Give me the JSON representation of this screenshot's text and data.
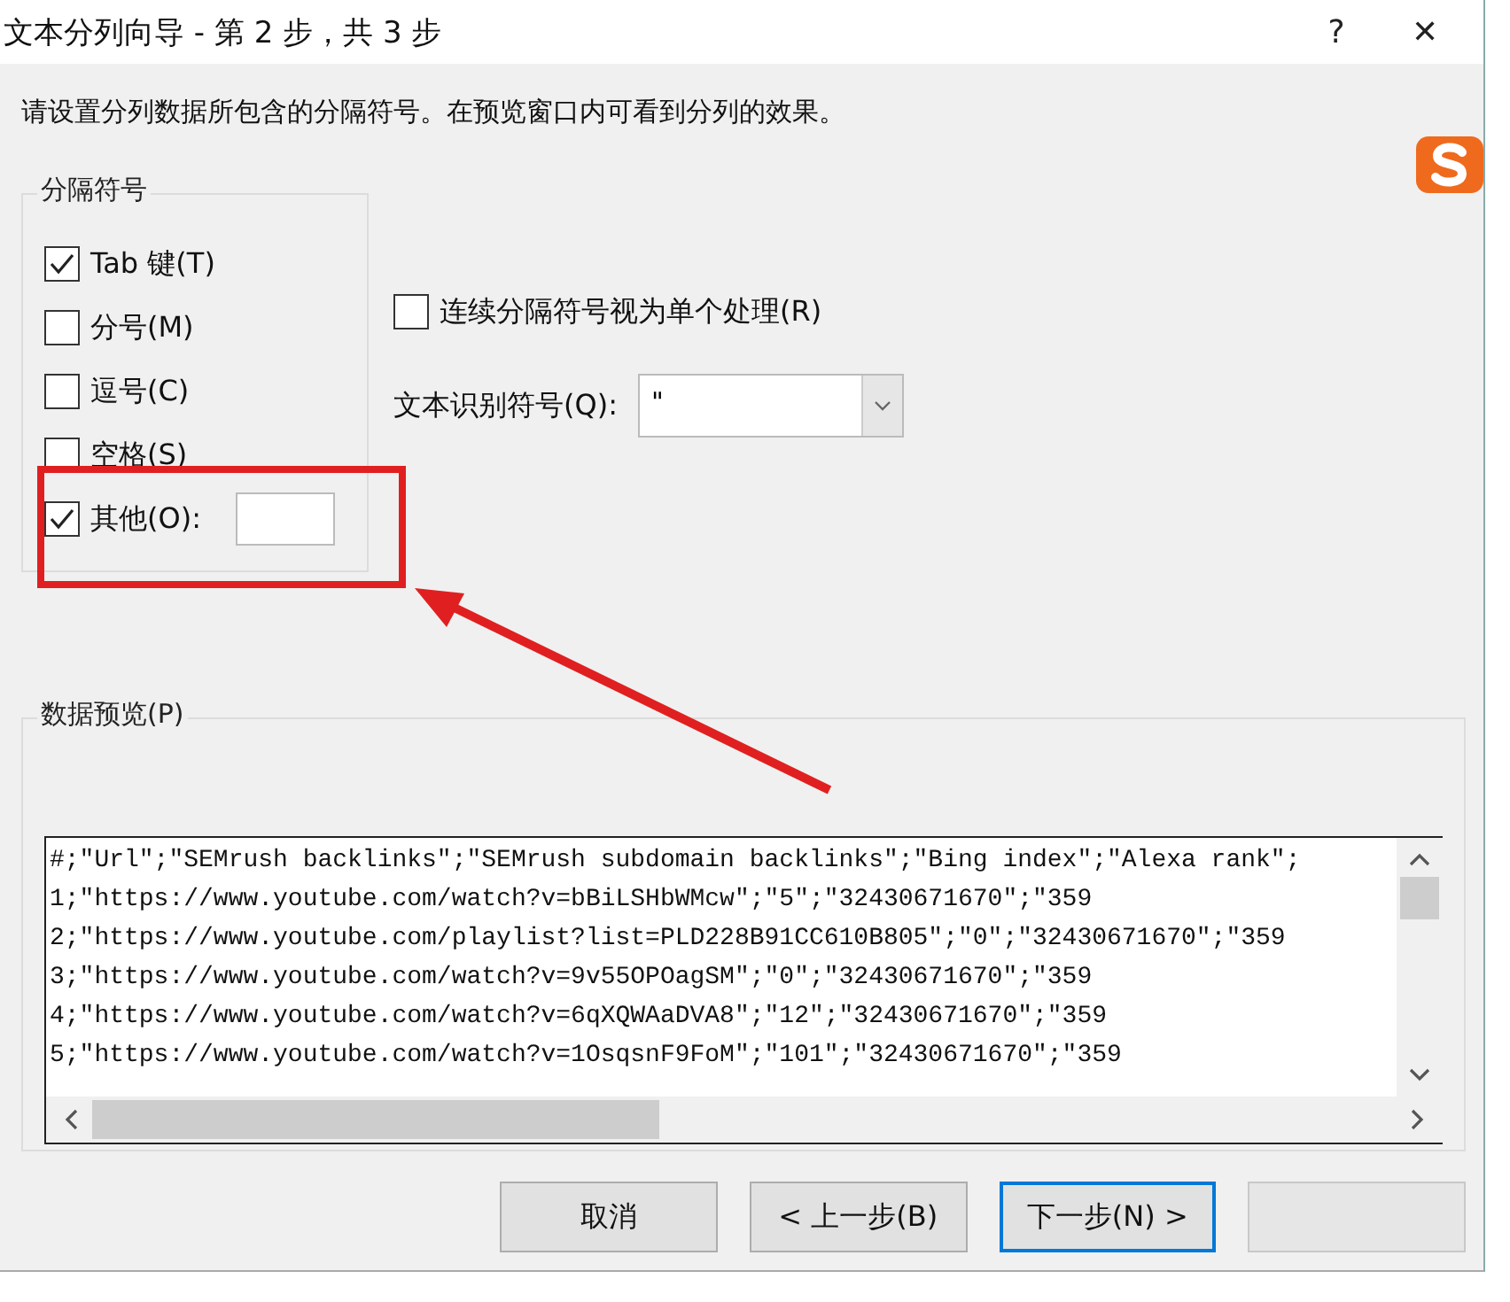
{
  "window": {
    "title": "文本分列向导 - 第 2 步，共 3 步",
    "help": "?",
    "close": "✕"
  },
  "instruction": "请设置分列数据所包含的分隔符号。在预览窗口内可看到分列的效果。",
  "delimiters": {
    "title": "分隔符号",
    "items": [
      {
        "label": "Tab 键(T)",
        "checked": true
      },
      {
        "label": "分号(M)",
        "checked": false
      },
      {
        "label": "逗号(C)",
        "checked": false
      },
      {
        "label": "空格(S)",
        "checked": false
      },
      {
        "label": "其他(O):",
        "checked": true,
        "kind": "with-field"
      }
    ]
  },
  "consecutive": {
    "label": "连续分隔符号视为单个处理(R)",
    "checked": false
  },
  "text_qualifier": {
    "label": "文本识别符号(Q):",
    "value": "\""
  },
  "preview": {
    "title": "数据预览(P)",
    "lines": [
      "#;\"Url\";\"SEMrush backlinks\";\"SEMrush subdomain backlinks\";\"Bing index\";\"Alexa rank\";",
      "1;\"https://www.youtube.com/watch?v=bBiLSHbWMcw\";\"5\";\"32430671670\";\"359",
      "2;\"https://www.youtube.com/playlist?list=PLD228B91CC610B805\";\"0\";\"32430671670\";\"359",
      "3;\"https://www.youtube.com/watch?v=9v55OPOagSM\";\"0\";\"32430671670\";\"359",
      "4;\"https://www.youtube.com/watch?v=6qXQWAaDVA8\";\"12\";\"32430671670\";\"359",
      "5;\"https://www.youtube.com/watch?v=1OsqsnF9FoM\";\"101\";\"32430671670\";\"359"
    ]
  },
  "buttons": [
    {
      "label": "取消",
      "focused": false,
      "disabled": false
    },
    {
      "label": "< 上一步(B)",
      "focused": false,
      "disabled": false
    },
    {
      "label": "下一步(N) >",
      "focused": true,
      "disabled": false
    },
    {
      "disabled": true,
      "focused": false
    }
  ],
  "highlight_box": {
    "color": "#e02020"
  },
  "arrow": {
    "color": "#e02020"
  }
}
